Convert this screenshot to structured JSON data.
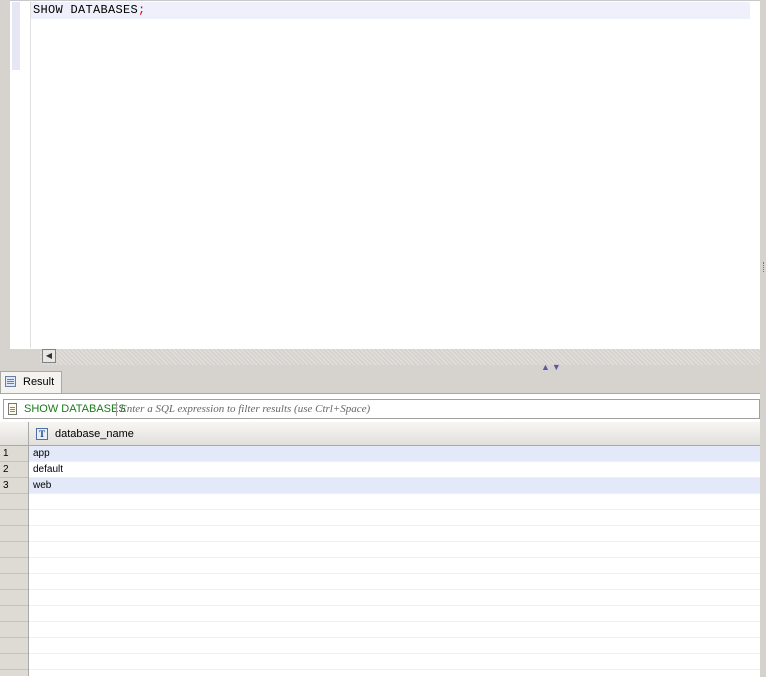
{
  "editor": {
    "sql_keyword": "SHOW DATABASES",
    "sql_terminator": ";"
  },
  "results_tab": {
    "label": "Result"
  },
  "filter_bar": {
    "query_label": "SHOW DATABASES",
    "placeholder": "Enter a SQL expression to filter results (use Ctrl+Space)"
  },
  "grid": {
    "column": {
      "type_icon": "T",
      "name": "database_name"
    },
    "rows": [
      {
        "num": "1",
        "value": "app"
      },
      {
        "num": "2",
        "value": "default"
      },
      {
        "num": "3",
        "value": "web"
      }
    ]
  },
  "sash_arrows": "▲▼"
}
